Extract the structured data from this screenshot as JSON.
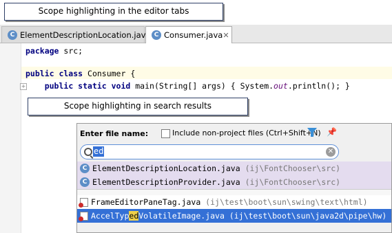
{
  "callouts": {
    "tabs": "Scope highlighting in the editor tabs",
    "search": "Scope highlighting in search results"
  },
  "tabs": [
    {
      "icon": "C",
      "label": "ElementDescriptionLocation.java",
      "close": "✕"
    },
    {
      "icon": "C",
      "label": "Consumer.java",
      "close": "✕"
    }
  ],
  "code": {
    "line1_kw": "package",
    "line1_rest": " src;",
    "line2_kw": "public class",
    "line2_rest": " Consumer {",
    "line3_kw": "public static void",
    "line3_mid": " main(String[] args) { System.",
    "line3_ital": "out",
    "line3_rest": ".println(); }"
  },
  "popup": {
    "title": "Enter file name:",
    "checkbox_label": "Include non-project files (Ctrl+Shift+N)",
    "query": "ed",
    "project_results": [
      {
        "name": "ElementDescriptionLocation.java",
        "path": " (ij\\FontChooser\\src)"
      },
      {
        "name": "ElementDescriptionProvider.java",
        "path": " (ij\\FontChooser\\src)"
      }
    ],
    "other_results": [
      {
        "name": "FrameEditorPaneTag.java",
        "path": " (ij\\test\\boot\\sun\\swing\\text\\html)"
      },
      {
        "name_pre": "AccelTyp",
        "name_match": "ed",
        "name_post": "VolatileImage.java",
        "path": " (ij\\test\\boot\\sun\\java2d\\pipe\\hw)"
      }
    ]
  },
  "colors": {
    "accent": "#3470d6",
    "project_scope": "#e4dcef",
    "class_icon": "#5d8ec7"
  }
}
